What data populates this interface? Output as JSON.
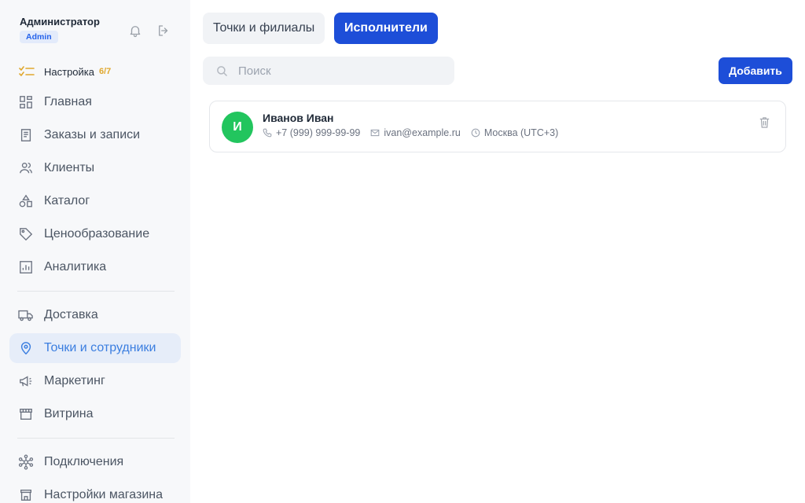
{
  "user": {
    "name": "Администратор",
    "role": "Admin"
  },
  "setup": {
    "label": "Настройка",
    "count": "6/7"
  },
  "nav": {
    "main": "Главная",
    "orders": "Заказы и записи",
    "clients": "Клиенты",
    "catalog": "Каталог",
    "pricing": "Ценообразование",
    "analytics": "Аналитика",
    "delivery": "Доставка",
    "locations": "Точки и сотрудники",
    "marketing": "Маркетинг",
    "storefront": "Витрина",
    "integrations": "Подключения",
    "store_settings": "Настройки магазина"
  },
  "tabs": {
    "branches": "Точки и филиалы",
    "performers": "Исполнители"
  },
  "search": {
    "placeholder": "Поиск"
  },
  "add_button": "Добавить",
  "performers": [
    {
      "initial": "И",
      "name": "Иванов Иван",
      "phone": "+7 (999) 999-99-99",
      "email": "ivan@example.ru",
      "timezone": "Москва (UTC+3)"
    }
  ],
  "colors": {
    "accent": "#1d4ed8",
    "active_nav": "#3b7ee0",
    "avatar": "#22c55e",
    "setup": "#e0a82e"
  }
}
